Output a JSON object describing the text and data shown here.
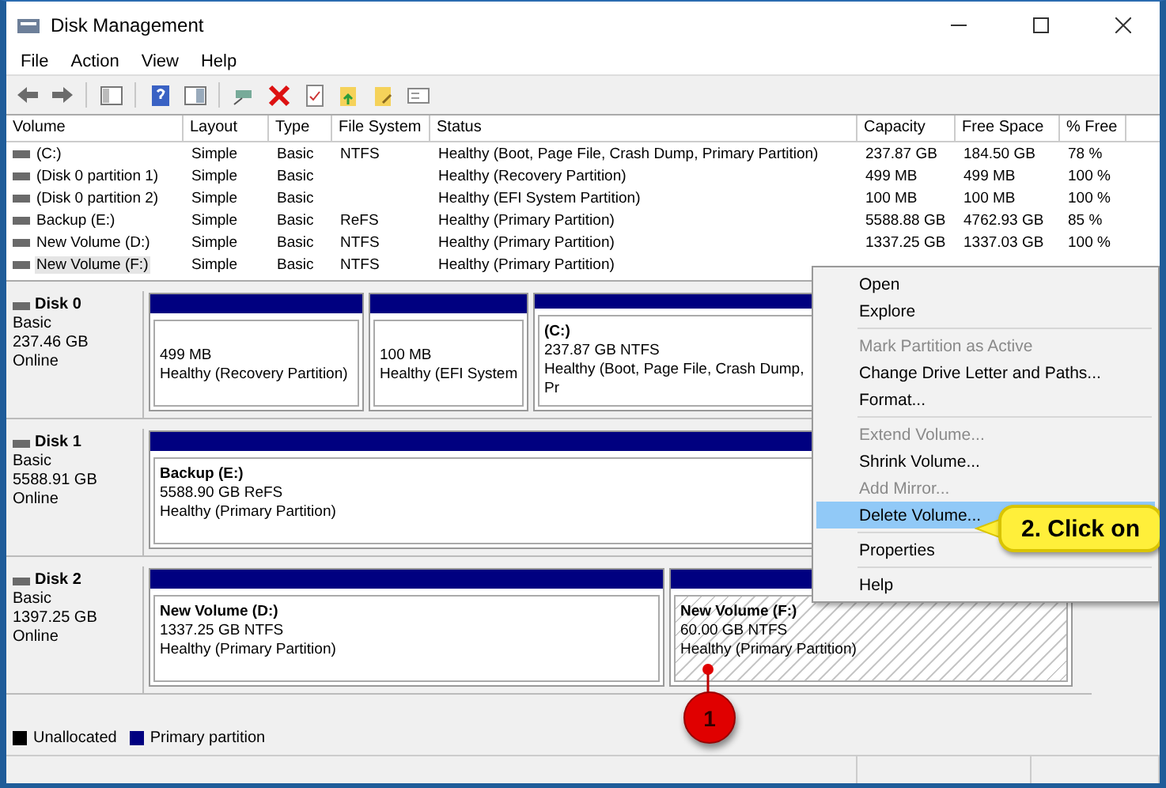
{
  "window": {
    "title": "Disk Management"
  },
  "menu": [
    "File",
    "Action",
    "View",
    "Help"
  ],
  "table": {
    "columns": [
      "Volume",
      "Layout",
      "Type",
      "File System",
      "Status",
      "Capacity",
      "Free Space",
      "% Free"
    ],
    "rows": [
      {
        "cells": [
          "(C:)",
          "Simple",
          "Basic",
          "NTFS",
          "Healthy (Boot, Page File, Crash Dump, Primary Partition)",
          "237.87 GB",
          "184.50 GB",
          "78 %"
        ],
        "selected": false
      },
      {
        "cells": [
          "(Disk 0 partition 1)",
          "Simple",
          "Basic",
          "",
          "Healthy (Recovery Partition)",
          "499 MB",
          "499 MB",
          "100 %"
        ],
        "selected": false
      },
      {
        "cells": [
          "(Disk 0 partition 2)",
          "Simple",
          "Basic",
          "",
          "Healthy (EFI System Partition)",
          "100 MB",
          "100 MB",
          "100 %"
        ],
        "selected": false
      },
      {
        "cells": [
          "Backup (E:)",
          "Simple",
          "Basic",
          "ReFS",
          "Healthy (Primary Partition)",
          "5588.88 GB",
          "4762.93 GB",
          "85 %"
        ],
        "selected": false
      },
      {
        "cells": [
          "New Volume (D:)",
          "Simple",
          "Basic",
          "NTFS",
          "Healthy (Primary Partition)",
          "1337.25 GB",
          "1337.03 GB",
          "100 %"
        ],
        "selected": false
      },
      {
        "cells": [
          "New Volume (F:)",
          "Simple",
          "Basic",
          "NTFS",
          "Healthy (Primary Partition)",
          "",
          "",
          ""
        ],
        "selected": true
      }
    ]
  },
  "disks": [
    {
      "name": "Disk 0",
      "type": "Basic",
      "size": "237.46 GB",
      "status": "Online",
      "partitions": [
        {
          "size": "499 MB",
          "status": "Healthy (Recovery Partition)",
          "selected": false
        },
        {
          "size": "100 MB",
          "status": "Healthy (EFI System",
          "selected": false
        },
        {
          "label": "(C:)",
          "size": "237.87 GB NTFS",
          "status": "Healthy (Boot, Page File, Crash Dump, Pr",
          "selected": false
        }
      ]
    },
    {
      "name": "Disk 1",
      "type": "Basic",
      "size": "5588.91 GB",
      "status": "Online",
      "partitions": [
        {
          "label": "Backup  (E:)",
          "size": "5588.90 GB ReFS",
          "status": "Healthy (Primary Partition)",
          "selected": false
        }
      ]
    },
    {
      "name": "Disk 2",
      "type": "Basic",
      "size": "1397.25 GB",
      "status": "Online",
      "partitions": [
        {
          "label": "New Volume  (D:)",
          "size": "1337.25 GB NTFS",
          "status": "Healthy (Primary Partition)",
          "selected": false
        },
        {
          "label": "New Volume  (F:)",
          "size": "60.00 GB NTFS",
          "status": "Healthy (Primary Partition)",
          "selected": true
        }
      ]
    }
  ],
  "legend": [
    {
      "label": "Unallocated",
      "color": "#000000"
    },
    {
      "label": "Primary partition",
      "color": "#000080"
    }
  ],
  "context_menu": [
    {
      "label": "Open",
      "disabled": false,
      "selected": false,
      "separator_after": false
    },
    {
      "label": "Explore",
      "disabled": false,
      "selected": false,
      "separator_after": true
    },
    {
      "label": "Mark Partition as Active",
      "disabled": true,
      "selected": false,
      "separator_after": false
    },
    {
      "label": "Change Drive Letter and Paths...",
      "disabled": false,
      "selected": false,
      "separator_after": false
    },
    {
      "label": "Format...",
      "disabled": false,
      "selected": false,
      "separator_after": true
    },
    {
      "label": "Extend Volume...",
      "disabled": true,
      "selected": false,
      "separator_after": false
    },
    {
      "label": "Shrink Volume...",
      "disabled": false,
      "selected": false,
      "separator_after": false
    },
    {
      "label": "Add Mirror...",
      "disabled": true,
      "selected": false,
      "separator_after": false
    },
    {
      "label": "Delete Volume...",
      "disabled": false,
      "selected": true,
      "separator_after": true
    },
    {
      "label": "Properties",
      "disabled": false,
      "selected": false,
      "separator_after": true
    },
    {
      "label": "Help",
      "disabled": false,
      "selected": false,
      "separator_after": false
    }
  ],
  "callouts": [
    {
      "kind": "bubble",
      "text": "2. Click on"
    },
    {
      "kind": "marker",
      "text": "1"
    }
  ]
}
